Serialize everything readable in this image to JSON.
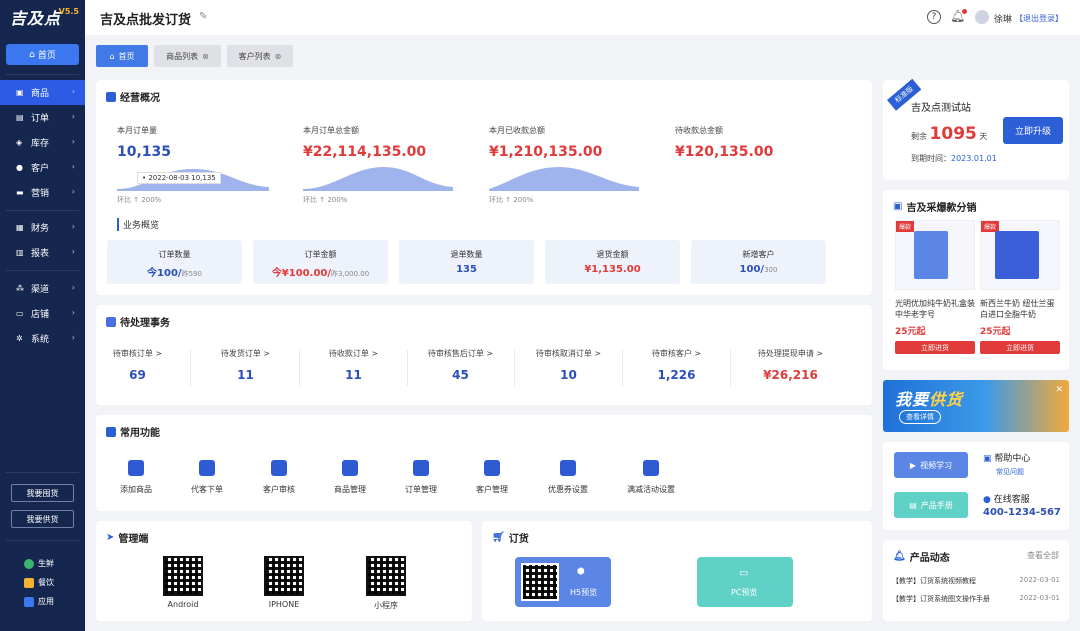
{
  "brand": {
    "logo_text": "吉及点",
    "version": "V5.5"
  },
  "sidebar": {
    "home": "首页",
    "group1": [
      {
        "label": "商品",
        "icon": "box-icon",
        "active": true
      },
      {
        "label": "订单",
        "icon": "order-icon"
      },
      {
        "label": "库存",
        "icon": "stock-icon"
      },
      {
        "label": "客户",
        "icon": "customer-icon"
      },
      {
        "label": "营销",
        "icon": "marketing-icon"
      }
    ],
    "group2": [
      {
        "label": "财务",
        "icon": "finance-icon"
      },
      {
        "label": "报表",
        "icon": "report-icon"
      }
    ],
    "group3": [
      {
        "label": "渠道",
        "icon": "channel-icon"
      },
      {
        "label": "店铺",
        "icon": "shop-icon"
      },
      {
        "label": "系统",
        "icon": "system-icon"
      }
    ],
    "buy_btn": "我要囤货",
    "supply_btn": "我要供货",
    "ext": [
      {
        "label": "生鲜",
        "color": "#3cb371"
      },
      {
        "label": "餐饮",
        "color": "#f5b335"
      },
      {
        "label": "应用",
        "color": "#3b78f0"
      }
    ]
  },
  "header": {
    "title": "吉及点批发订货",
    "user": "徐琳",
    "logout": "【退出登录】",
    "help": "?"
  },
  "tabs": [
    {
      "label": "首页",
      "active": true
    },
    {
      "label": "商品列表"
    },
    {
      "label": "客户列表"
    }
  ],
  "overview": {
    "title": "经营概况",
    "stats": [
      {
        "label": "本月订单量",
        "value": "10,135",
        "ratio": "环比 ↑  200%"
      },
      {
        "label": "本月订单总金额",
        "value": "¥22,114,135.00",
        "ratio": "环比 ↑  200%"
      },
      {
        "label": "本月已收款总额",
        "value": "¥1,210,135.00",
        "ratio": "环比 ↑  200%"
      },
      {
        "label": "待收款总金额",
        "value": "¥120,135.00"
      }
    ],
    "tooltip": "• 2022-08-03 10,135",
    "biz_title": "业务概览",
    "biz": [
      {
        "label": "订单数量",
        "value": "今100/",
        "sub": "昨590"
      },
      {
        "label": "订单金额",
        "value": "今¥100.00/",
        "sub": "昨3,000.00"
      },
      {
        "label": "退单数量",
        "value": "135",
        "sub": ""
      },
      {
        "label": "退货金额",
        "value": "¥1,135.00",
        "sub": ""
      },
      {
        "label": "新增客户",
        "value": "100/",
        "sub": "300"
      }
    ]
  },
  "pending": {
    "title": "待处理事务",
    "items": [
      {
        "label": "待审核订单 >",
        "value": "69"
      },
      {
        "label": "待发货订单 >",
        "value": "11"
      },
      {
        "label": "待收款订单 >",
        "value": "11"
      },
      {
        "label": "待审核售后订单 >",
        "value": "45"
      },
      {
        "label": "待审核取消订单 >",
        "value": "10"
      },
      {
        "label": "待审核客户 >",
        "value": "1,226"
      },
      {
        "label": "待处理提现申请 >",
        "value": "¥26,216"
      }
    ]
  },
  "functions": {
    "title": "常用功能",
    "items": [
      "添加商品",
      "代客下单",
      "客户审核",
      "商品管理",
      "订单管理",
      "客户管理",
      "优惠券设置",
      "满减活动设置"
    ]
  },
  "admin": {
    "title": "管理端",
    "qrs": [
      "Android",
      "IPHONE",
      "小程序"
    ]
  },
  "order_panel": {
    "title": "订货",
    "h5": "H5预览",
    "pc": "PC预览"
  },
  "station": {
    "ribbon": "标准版",
    "name": "吉及点测试站",
    "remain_label": "剩余",
    "remain_days": "1095",
    "days_unit": "天",
    "expire_label": "到期时间：",
    "expire_date": "2023.01.01",
    "upgrade": "立即升级"
  },
  "distribution": {
    "title": "吉及采爆款分销",
    "products": [
      {
        "tag": "爆款",
        "name": "光明优加纯牛奶礼盒装中华老字号",
        "price": "25元起",
        "btn": "立即进货"
      },
      {
        "tag": "爆款",
        "name": "新西兰牛奶 纽仕兰蛋白进口全脂牛奶",
        "price": "25元起",
        "btn": "立即进货"
      }
    ]
  },
  "banner": {
    "text1": "我要",
    "text2": "供货",
    "look": "查看详情",
    "close": "✕"
  },
  "helpbox": {
    "video": "视频学习",
    "manual": "产品手册",
    "help_center": "帮助中心",
    "faq": "常见问题",
    "service": "在线客服",
    "phone": "400-1234-567"
  },
  "news": {
    "title": "产品动态",
    "more": "查看全部",
    "items": [
      {
        "text": "【教学】订货系统视频教程",
        "date": "2022-03-01"
      },
      {
        "text": "【教学】订货系统图文操作手册",
        "date": "2022-03-01"
      }
    ]
  }
}
